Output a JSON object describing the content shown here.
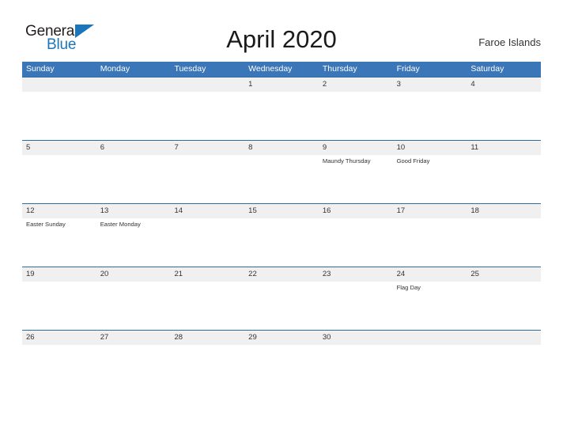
{
  "branding": {
    "logo_primary": "General",
    "logo_secondary": "Blue",
    "flag_icon": "blue-triangle-flag-icon",
    "accent_color": "#1b75bb"
  },
  "header": {
    "title": "April 2020",
    "country": "Faroe Islands"
  },
  "calendar": {
    "header_color": "#3a76b8",
    "band_color": "#f0f0f0",
    "weekdays": [
      "Sunday",
      "Monday",
      "Tuesday",
      "Wednesday",
      "Thursday",
      "Friday",
      "Saturday"
    ],
    "weeks": [
      [
        {
          "num": ""
        },
        {
          "num": ""
        },
        {
          "num": ""
        },
        {
          "num": "1"
        },
        {
          "num": "2"
        },
        {
          "num": "3"
        },
        {
          "num": "4"
        }
      ],
      [
        {
          "num": "5"
        },
        {
          "num": "6"
        },
        {
          "num": "7"
        },
        {
          "num": "8"
        },
        {
          "num": "9",
          "event": "Maundy Thursday"
        },
        {
          "num": "10",
          "event": "Good Friday"
        },
        {
          "num": "11"
        }
      ],
      [
        {
          "num": "12",
          "event": "Easter Sunday"
        },
        {
          "num": "13",
          "event": "Easter Monday"
        },
        {
          "num": "14"
        },
        {
          "num": "15"
        },
        {
          "num": "16"
        },
        {
          "num": "17"
        },
        {
          "num": "18"
        }
      ],
      [
        {
          "num": "19"
        },
        {
          "num": "20"
        },
        {
          "num": "21"
        },
        {
          "num": "22"
        },
        {
          "num": "23"
        },
        {
          "num": "24",
          "event": "Flag Day"
        },
        {
          "num": "25"
        }
      ],
      [
        {
          "num": "26"
        },
        {
          "num": "27"
        },
        {
          "num": "28"
        },
        {
          "num": "29"
        },
        {
          "num": "30"
        },
        {
          "num": ""
        },
        {
          "num": ""
        }
      ]
    ]
  }
}
